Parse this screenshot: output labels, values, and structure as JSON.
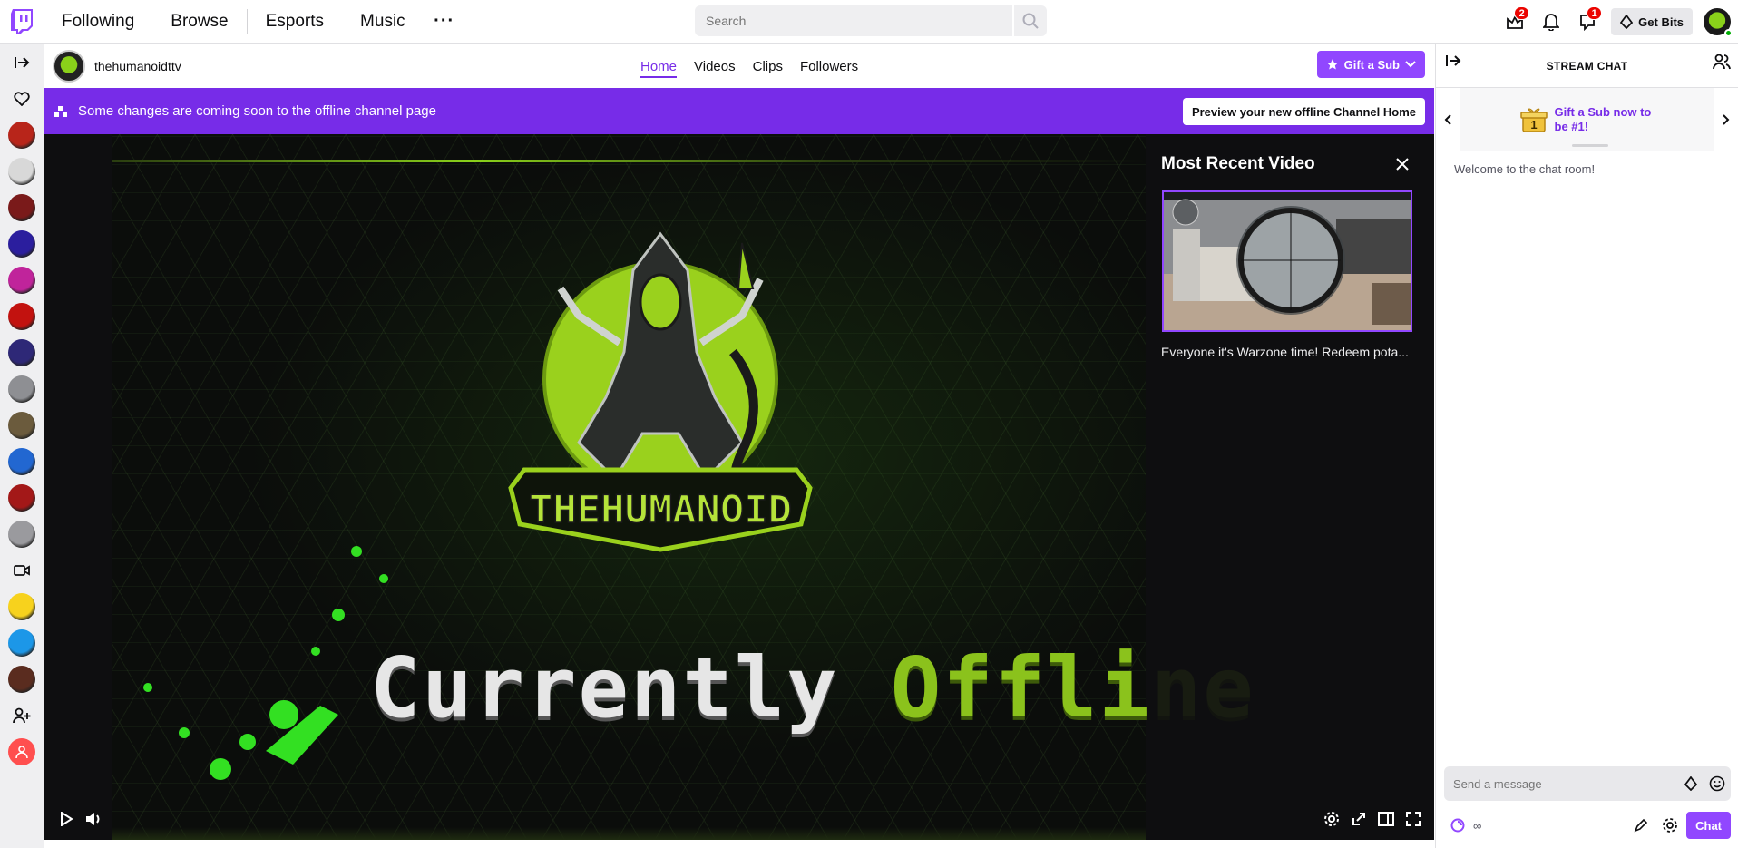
{
  "nav": {
    "links": [
      "Following",
      "Browse",
      "Esports",
      "Music"
    ],
    "search_placeholder": "Search",
    "badges": {
      "prime_count": "2",
      "whispers_count": "1"
    },
    "get_bits_label": "Get Bits"
  },
  "sidebar": {
    "avatars": [
      "#b8251a",
      "#d8d8d8",
      "#7a1a1a",
      "#2b1e9e",
      "#c0249b",
      "#c2120f",
      "#2e2877",
      "#8e8f93",
      "#6b5b3d",
      "#2267d1",
      "#a31818",
      "#9a9a9e",
      "#f7d21d",
      "#1c97e8",
      "#5a2c1f"
    ]
  },
  "channel": {
    "name": "thehumanoidttv",
    "tabs": [
      "Home",
      "Videos",
      "Clips",
      "Followers"
    ],
    "active_tab": "Home",
    "gift_button_label": "Gift a Sub"
  },
  "banner": {
    "text": "Some changes are coming soon to the offline channel page",
    "button_label": "Preview your new offline Channel Home"
  },
  "player": {
    "offline_word1": "Currently",
    "offline_word2": "Offline",
    "logo_text": "THEHUMANOID",
    "recent_video": {
      "heading": "Most Recent Video",
      "caption": "Everyone it's Warzone time! Redeem pota..."
    }
  },
  "chat": {
    "title": "STREAM CHAT",
    "gift_promo": "Gift a Sub now to be #1!",
    "gift_rank": "1",
    "welcome": "Welcome to the chat room!",
    "input_placeholder": "Send a message",
    "points": "∞",
    "send_label": "Chat"
  },
  "colors": {
    "accent": "#9147ff",
    "accent_dark": "#772ce8",
    "brand_green": "#8bc21c"
  }
}
